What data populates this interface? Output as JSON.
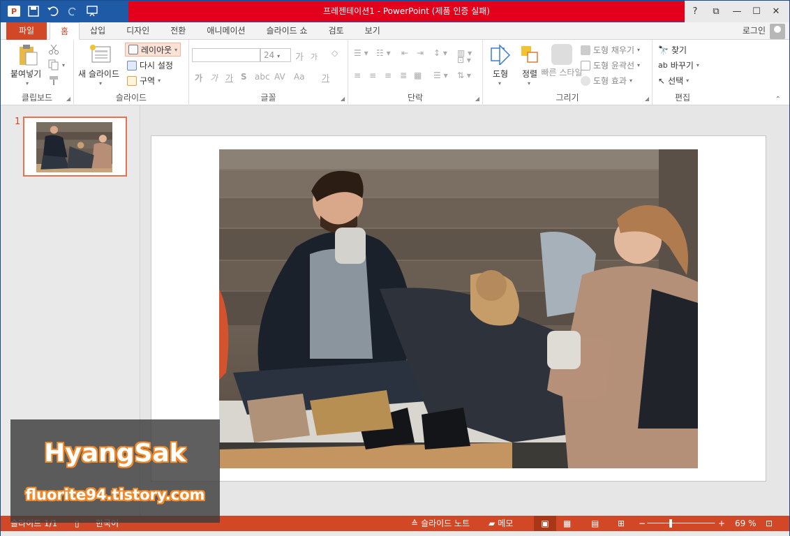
{
  "window": {
    "title": "프레젠테이션1 - PowerPoint (제품 인증 실패)"
  },
  "titlebar": {
    "help": "?",
    "restore_ribbon": "⧉",
    "minimize": "—",
    "maximize": "☐",
    "close": "✕"
  },
  "tabs": {
    "file": "파일",
    "items": [
      "홈",
      "삽입",
      "디자인",
      "전환",
      "애니메이션",
      "슬라이드 쇼",
      "검토",
      "보기"
    ],
    "active": "홈",
    "login": "로그인"
  },
  "ribbon": {
    "clipboard": {
      "label": "클립보드",
      "paste": "붙여넣기"
    },
    "slides": {
      "label": "슬라이드",
      "new_slide": "새 슬라이드",
      "layout": "레이아웃",
      "reset": "다시 설정",
      "section": "구역"
    },
    "font": {
      "label": "글꼴",
      "font_name": "",
      "font_size": "24",
      "grow": "가",
      "shrink": "가",
      "bold": "가",
      "italic": "가",
      "underline": "가",
      "shadow": "S",
      "spacing": "AV",
      "case": "Aa",
      "color": "가"
    },
    "paragraph": {
      "label": "단락"
    },
    "drawing": {
      "label": "그리기",
      "shapes": "도형",
      "arrange": "정렬",
      "quick_styles": "빠른 스타일",
      "fill": "도형 채우기",
      "outline": "도형 윤곽선",
      "effects": "도형 효과"
    },
    "editing": {
      "label": "편집",
      "find": "찾기",
      "replace": "바꾸기",
      "select": "선택"
    }
  },
  "slides_pane": {
    "slide_number": "1"
  },
  "statusbar": {
    "slide_info": "슬라이드 1/1",
    "language": "한국어",
    "notes": "슬라이드 노트",
    "comments": "메모",
    "zoom": "69 %",
    "zoom_minus": "−",
    "zoom_plus": "+"
  },
  "watermark": {
    "name": "HyangSak",
    "url": "fluorite94.tistory.com"
  },
  "colors": {
    "accent": "#d24726",
    "title_red": "#e3001b",
    "title_blue": "#1f5aa6"
  },
  "icons": [
    "powerpoint-logo-icon",
    "save-icon",
    "undo-icon",
    "redo-icon",
    "present-icon",
    "paste-icon",
    "cut-icon",
    "copy-icon",
    "format-painter-icon",
    "new-slide-icon",
    "layout-icon",
    "reset-icon",
    "section-icon",
    "shapes-icon",
    "arrange-icon",
    "quick-styles-icon",
    "find-icon",
    "replace-icon",
    "select-icon",
    "notes-icon",
    "comments-icon",
    "normal-view-icon",
    "sorter-view-icon",
    "reading-view-icon",
    "slideshow-view-icon",
    "fit-slide-icon"
  ]
}
